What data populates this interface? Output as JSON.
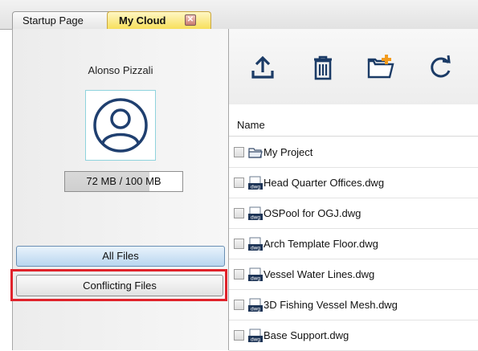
{
  "tabs": [
    {
      "label": "Startup Page"
    },
    {
      "label": "My Cloud",
      "active": true
    }
  ],
  "tab_close_glyph": "✕",
  "user": {
    "name": "Alonso Pizzali",
    "storage_text": "72 MB / 100 MB",
    "storage_used_fraction": 0.72
  },
  "nav": {
    "all_files": "All Files",
    "conflicting_files": "Conflicting Files"
  },
  "toolbar": {
    "icons": [
      "upload-icon",
      "delete-icon",
      "new-folder-icon",
      "refresh-icon"
    ]
  },
  "file_list": {
    "column_header": "Name",
    "items": [
      {
        "name": "My Project",
        "type": "folder"
      },
      {
        "name": "Head Quarter Offices.dwg",
        "type": "dwg"
      },
      {
        "name": "OSPool for OGJ.dwg",
        "type": "dwg"
      },
      {
        "name": "Arch Template Floor.dwg",
        "type": "dwg"
      },
      {
        "name": "Vessel Water Lines.dwg",
        "type": "dwg"
      },
      {
        "name": "3D Fishing Vessel Mesh.dwg",
        "type": "dwg"
      },
      {
        "name": "Base Support.dwg",
        "type": "dwg"
      }
    ]
  },
  "file_icon_badge": "dwg",
  "colors": {
    "highlight_outline": "#e0232b",
    "active_tab": "#f7df5c",
    "selected_button": "#b9d6ef"
  }
}
